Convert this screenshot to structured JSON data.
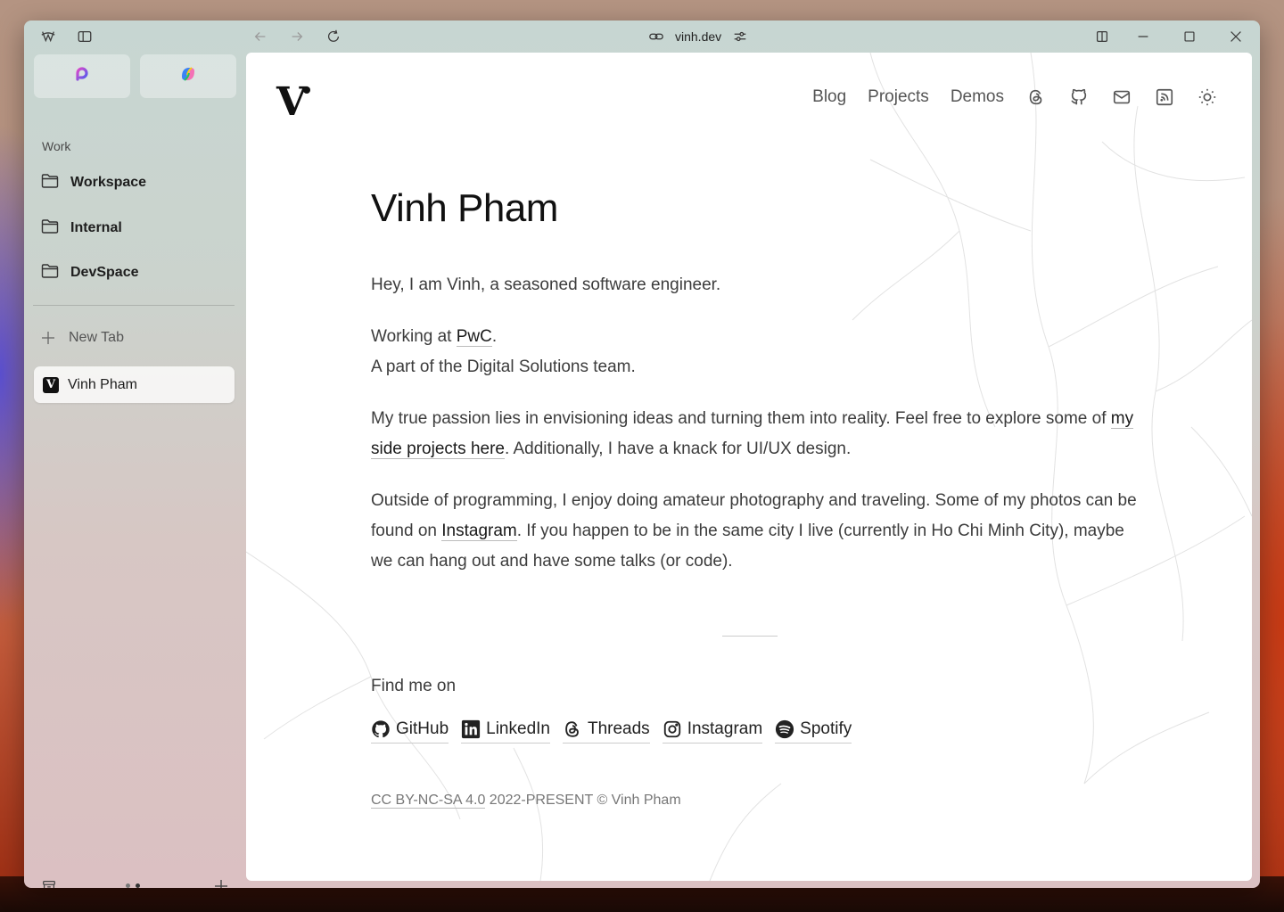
{
  "browser": {
    "url": "vinh.dev"
  },
  "sidebar": {
    "section_label": "Work",
    "folders": [
      {
        "label": "Workspace"
      },
      {
        "label": "Internal"
      },
      {
        "label": "DevSpace"
      }
    ],
    "new_tab_label": "New Tab",
    "active_tab": {
      "label": "Vinh Pham",
      "favicon": "V"
    }
  },
  "site": {
    "logo": "V",
    "nav": {
      "blog": "Blog",
      "projects": "Projects",
      "demos": "Demos"
    },
    "title": "Vinh Pham",
    "intro": "Hey, I am Vinh, a seasoned software engineer.",
    "work_prefix": "Working at ",
    "work_company": "PwC",
    "work_suffix": ".",
    "team": "A part of the Digital Solutions team.",
    "passion_a": "My true passion lies in envisioning ideas and turning them into reality. Feel free to explore some of ",
    "passion_link": "my side projects here",
    "passion_b": ". Additionally, I have a knack for UI/UX design.",
    "outside_a": "Outside of programming, I enjoy doing amateur photography and traveling. Some of my photos can be found on ",
    "outside_link": "Instagram",
    "outside_b": ". If you happen to be in the same city I live (currently in Ho Chi Minh City), maybe we can hang out and have some talks (or code).",
    "find_me": "Find me on",
    "socials": [
      {
        "label": "GitHub",
        "icon": "github-icon"
      },
      {
        "label": "LinkedIn",
        "icon": "linkedin-icon"
      },
      {
        "label": "Threads",
        "icon": "threads-icon"
      },
      {
        "label": "Instagram",
        "icon": "instagram-icon"
      },
      {
        "label": "Spotify",
        "icon": "spotify-icon"
      }
    ],
    "footer_license": "CC BY-NC-SA 4.0",
    "footer_rest": " 2022-PRESENT © Vinh Pham"
  }
}
